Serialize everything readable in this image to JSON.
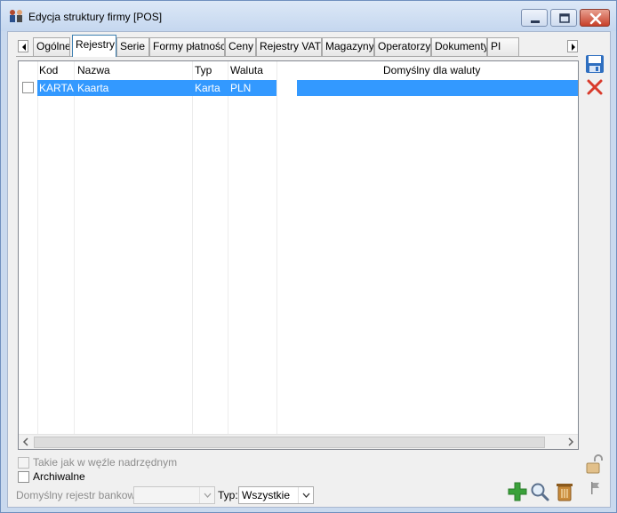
{
  "window": {
    "title": "Edycja struktury firmy [POS]",
    "buttons": [
      "minimize",
      "maximize",
      "close"
    ]
  },
  "tabs": [
    {
      "label": "Ogólne",
      "active": false
    },
    {
      "label": "Rejestry",
      "active": true
    },
    {
      "label": "Serie",
      "active": false
    },
    {
      "label": "Formy płatności",
      "active": false
    },
    {
      "label": "Ceny",
      "active": false
    },
    {
      "label": "Rejestry VAT",
      "active": false
    },
    {
      "label": "Magazyny",
      "active": false
    },
    {
      "label": "Operatorzy",
      "active": false
    },
    {
      "label": "Dokumenty",
      "active": false
    },
    {
      "label": "PI",
      "active": false
    }
  ],
  "grid": {
    "columns": [
      "Kod",
      "Nazwa",
      "Typ",
      "Waluta",
      "Domyślny dla waluty"
    ],
    "rows": [
      {
        "checked": false,
        "selected": true,
        "kod": "KARTA",
        "nazwa": "Kaarta",
        "typ": "Karta",
        "waluta": "PLN",
        "domyslny": ""
      }
    ]
  },
  "bottom": {
    "takie_jak_label": "Takie jak w węźle nadrzędnym",
    "takie_jak_checked": false,
    "archiwalne_label": "Archiwalne",
    "archiwalne_checked": false,
    "rejestr_label": "Domyślny rejestr bankowy:",
    "rejestr_value": "",
    "typ_label": "Typ:",
    "typ_value": "Wszystkie"
  },
  "icons": {
    "save": "save-icon",
    "cancel": "cancel-icon",
    "lock": "padlock-icon",
    "flag": "flag-icon",
    "add": "add-icon",
    "search": "search-icon",
    "delete": "delete-icon"
  },
  "colors": {
    "selection": "#3399ff",
    "window_frame": "#c9d9ee",
    "close_button": "#c7402a"
  }
}
